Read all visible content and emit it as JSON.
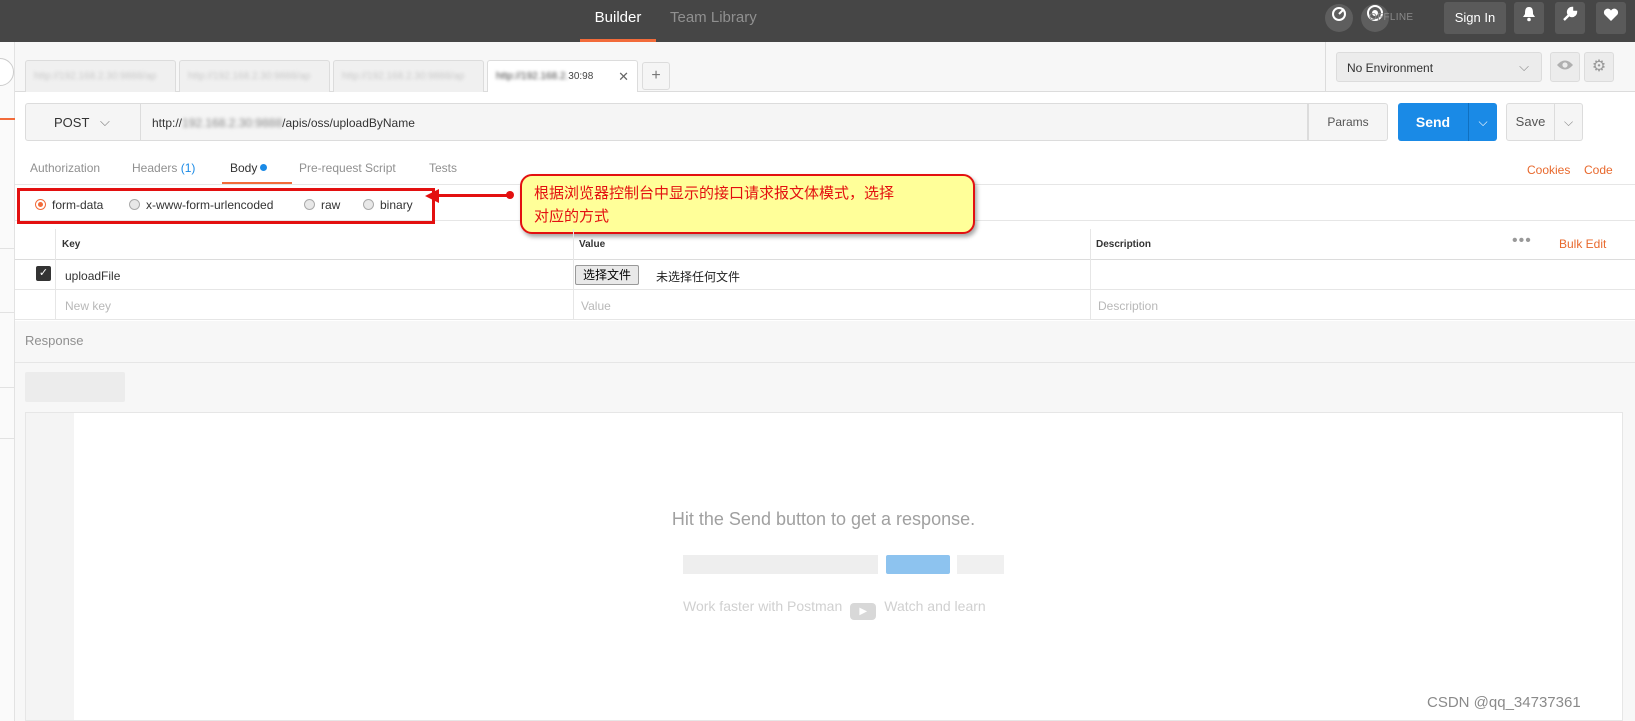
{
  "topbar": {
    "tabs": [
      "Builder",
      "Team Library"
    ],
    "offline_label": "OFFLINE",
    "signin_label": "Sign In",
    "icons": [
      "satellite-icon",
      "sync-icon",
      "bell-icon",
      "wrench-icon",
      "heart-icon"
    ]
  },
  "request_tabs": [
    {
      "label": "http://192.168.2.30:9888/ap"
    },
    {
      "label": "http://192.168.2.30:9888/ap"
    },
    {
      "label": "http://192.168.2.30:9888/ap"
    },
    {
      "label_blurred": "http://192.168.2.",
      "label": "30:98"
    }
  ],
  "environment": {
    "selected": "No Environment"
  },
  "request": {
    "method": "POST",
    "url_prefix": "http://",
    "url_blurred": "192.168.2.30:9888",
    "url_path": "/apis/oss/uploadByName",
    "params_label": "Params",
    "send_label": "Send",
    "save_label": "Save"
  },
  "subtabs": {
    "authorization": "Authorization",
    "headers": "Headers",
    "headers_count": "(1)",
    "body": "Body",
    "prerequest": "Pre-request Script",
    "tests": "Tests",
    "cookies": "Cookies",
    "code": "Code"
  },
  "body_modes": {
    "selected": "form-data",
    "options": [
      "form-data",
      "x-www-form-urlencoded",
      "raw",
      "binary"
    ]
  },
  "annotation": {
    "line1": "根据浏览器控制台中显示的接口请求报文体模式，选择",
    "line2": "对应的方式",
    "color": "#e31010"
  },
  "table": {
    "headers": {
      "key": "Key",
      "value": "Value",
      "description": "Description"
    },
    "dots": "•••",
    "bulk_edit": "Bulk Edit",
    "rows": [
      {
        "checked": true,
        "key": "uploadFile",
        "file_button": "选择文件",
        "file_status": "未选择任何文件"
      }
    ],
    "placeholders": {
      "key": "New key",
      "value": "Value",
      "description": "Description"
    }
  },
  "response": {
    "title": "Response",
    "hint": "Hit the Send button to get a response.",
    "learn_left": "Work faster with Postman",
    "learn_right": "Watch and learn"
  },
  "watermark": "CSDN @qq_34737361",
  "colors": {
    "accent": "#f26b3a",
    "send": "#1a8ae6",
    "topbar": "#464646",
    "link": "#e8692d"
  }
}
